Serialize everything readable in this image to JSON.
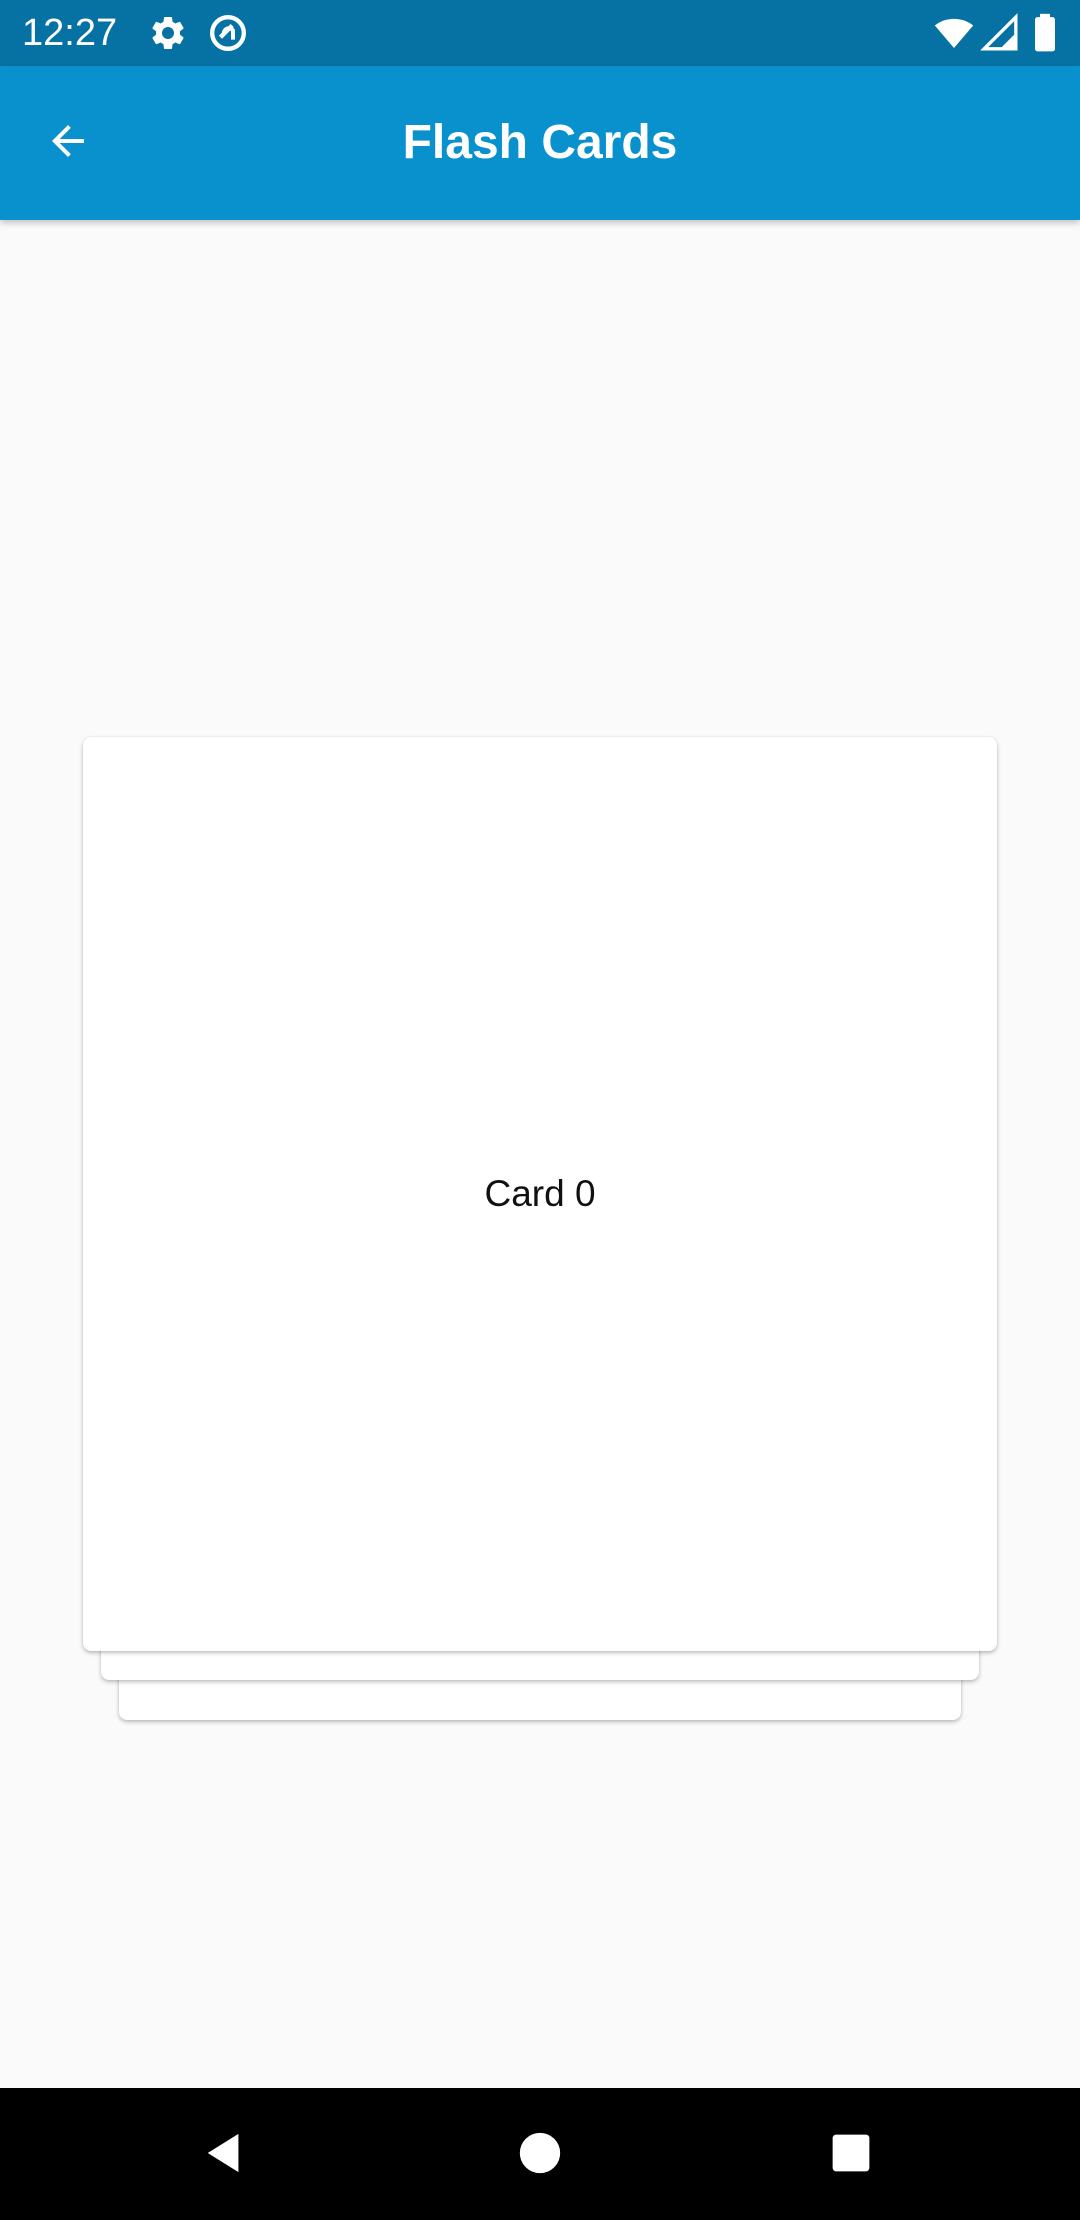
{
  "status_bar": {
    "time": "12:27",
    "icons": [
      "settings-icon",
      "sync-icon",
      "wifi-icon",
      "signal-icon",
      "battery-icon"
    ]
  },
  "app_bar": {
    "title": "Flash Cards",
    "back_icon": "arrow-left-icon",
    "background": "#0891cd"
  },
  "cards": {
    "front_label": "Card 0"
  },
  "nav_bar": {
    "buttons": [
      "back-triangle-icon",
      "home-circle-icon",
      "recents-square-icon"
    ]
  },
  "colors": {
    "status_bar": "#0672a4",
    "app_bar": "#0891cd",
    "background": "#fafafa",
    "card": "#ffffff"
  }
}
